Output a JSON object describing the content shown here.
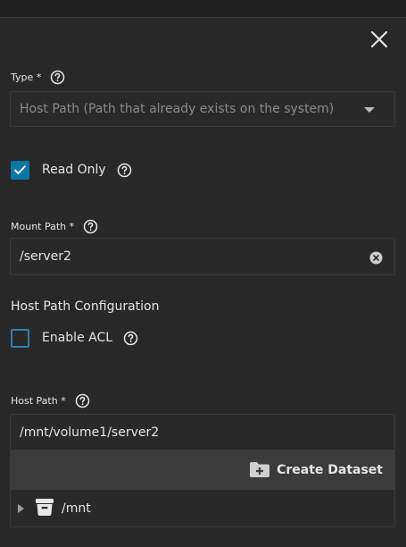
{
  "close": {
    "icon": "close-icon"
  },
  "type_field": {
    "label": "Type *",
    "value": "Host Path (Path that already exists on the system)"
  },
  "read_only": {
    "label": "Read Only",
    "checked": true
  },
  "mount_path": {
    "label": "Mount Path *",
    "value": "/server2"
  },
  "host_path_config": {
    "title": "Host Path Configuration"
  },
  "enable_acl": {
    "label": "Enable ACL",
    "checked": false
  },
  "host_path": {
    "label": "Host Path *",
    "value": "/mnt/volume1/server2",
    "create_dataset_label": "Create Dataset",
    "tree": [
      {
        "label": "/mnt",
        "icon": "dataset-icon"
      }
    ]
  },
  "colors": {
    "accent": "#0b76a8",
    "background": "#282828"
  }
}
